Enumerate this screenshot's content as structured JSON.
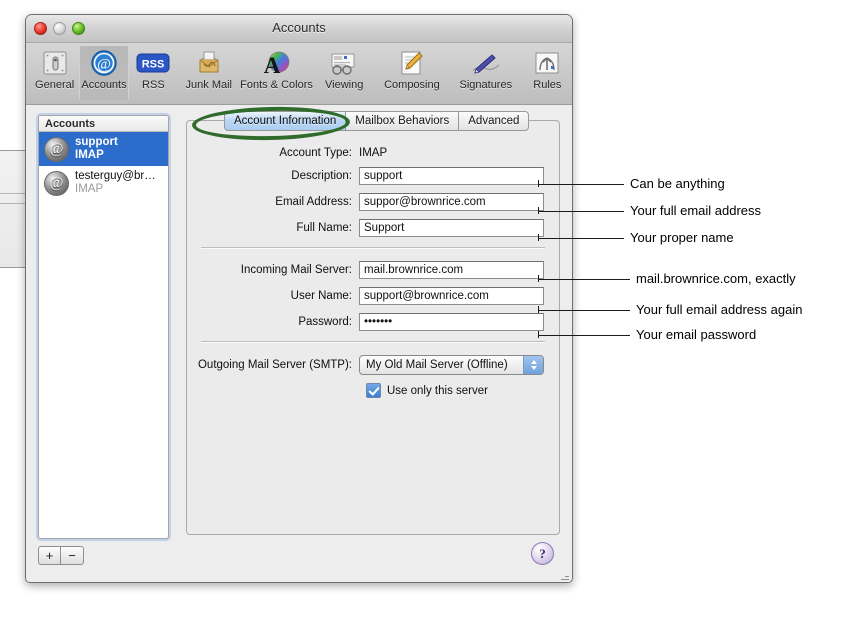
{
  "window": {
    "title": "Accounts",
    "traffic_lights": [
      "close-button",
      "minimize-button",
      "zoom-button"
    ]
  },
  "toolbar": {
    "items": [
      {
        "label": "General",
        "icon": "general-icon",
        "selected": false
      },
      {
        "label": "Accounts",
        "icon": "at-sign-icon",
        "selected": true
      },
      {
        "label": "RSS",
        "icon": "rss-icon",
        "selected": false
      },
      {
        "label": "Junk Mail",
        "icon": "junk-mail-icon",
        "selected": false
      },
      {
        "label": "Fonts & Colors",
        "icon": "fonts-colors-icon",
        "selected": false
      },
      {
        "label": "Viewing",
        "icon": "viewing-icon",
        "selected": false
      },
      {
        "label": "Composing",
        "icon": "composing-icon",
        "selected": false
      },
      {
        "label": "Signatures",
        "icon": "signatures-icon",
        "selected": false
      },
      {
        "label": "Rules",
        "icon": "rules-icon",
        "selected": false
      }
    ]
  },
  "accounts_list": {
    "header": "Accounts",
    "add_label": "+",
    "remove_label": "−",
    "items": [
      {
        "name": "support",
        "type": "IMAP",
        "selected": true
      },
      {
        "name": "testerguy@br…",
        "type": "IMAP",
        "selected": false
      }
    ]
  },
  "tabs": [
    {
      "label": "Account Information",
      "active": true
    },
    {
      "label": "Mailbox Behaviors",
      "active": false
    },
    {
      "label": "Advanced",
      "active": false
    }
  ],
  "form": {
    "account_type": {
      "label": "Account Type:",
      "value": "IMAP"
    },
    "fields": [
      {
        "label": "Description:",
        "value": "support",
        "type": "text"
      },
      {
        "label": "Email Address:",
        "value": "suppor@brownrice.com",
        "type": "text"
      },
      {
        "label": "Full Name:",
        "value": "Support",
        "type": "text"
      },
      {
        "label": "Incoming Mail Server:",
        "value": "mail.brownrice.com",
        "type": "text"
      },
      {
        "label": "User Name:",
        "value": "support@brownrice.com",
        "type": "text"
      },
      {
        "label": "Password:",
        "value": "•••••••",
        "type": "password"
      }
    ],
    "smtp": {
      "label": "Outgoing Mail Server (SMTP):",
      "selected_option": "My Old Mail Server (Offline)"
    },
    "use_only_this_server": {
      "label": "Use only this server",
      "checked": true
    }
  },
  "help_button": {
    "label": "?"
  },
  "annotations": [
    {
      "text": "Can be anything"
    },
    {
      "text": "Your full email address"
    },
    {
      "text": "Your proper name"
    },
    {
      "text": "mail.brownrice.com, exactly"
    },
    {
      "text": "Your full email address again"
    },
    {
      "text": "Your email password"
    }
  ],
  "highlight": {
    "shape": "ellipse",
    "color": "#2f6b2b",
    "target": "Account Information"
  }
}
